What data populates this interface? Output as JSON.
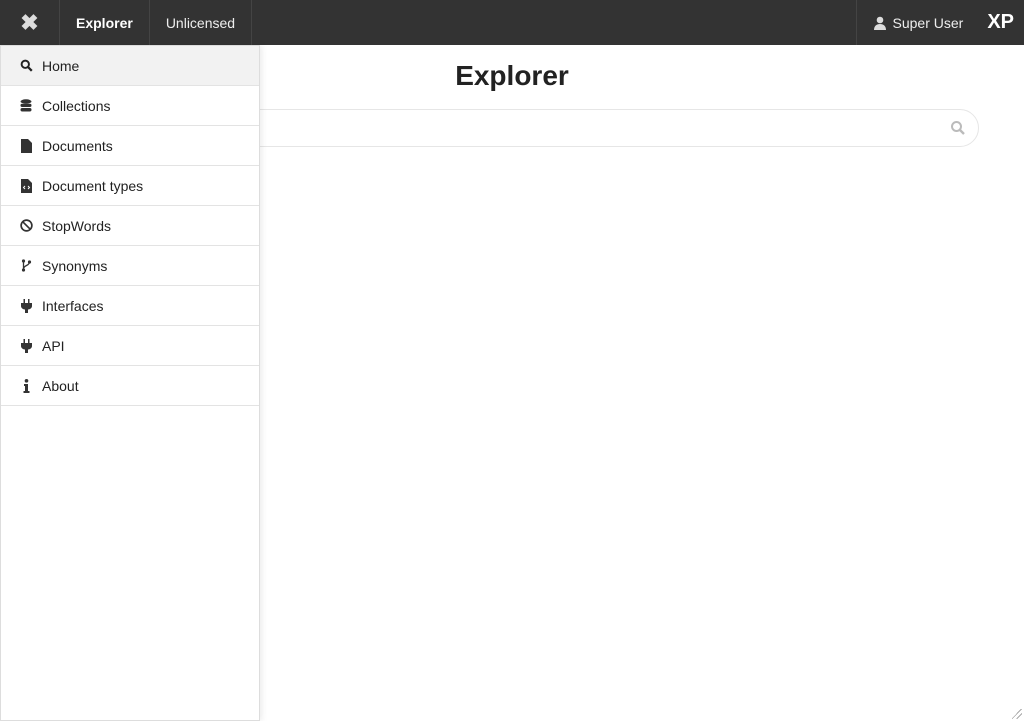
{
  "topbar": {
    "close_icon": "close-icon",
    "app_name": "Explorer",
    "license": "Unlicensed",
    "user": "Super User",
    "logo": "XP"
  },
  "main": {
    "title": "Explorer",
    "search": {
      "value": "",
      "placeholder": ""
    }
  },
  "menu": {
    "items": [
      {
        "label": "Home",
        "icon": "search-icon"
      },
      {
        "label": "Collections",
        "icon": "database-icon"
      },
      {
        "label": "Documents",
        "icon": "file-icon"
      },
      {
        "label": "Document types",
        "icon": "file-code-icon"
      },
      {
        "label": "StopWords",
        "icon": "ban-icon"
      },
      {
        "label": "Synonyms",
        "icon": "code-branch-icon"
      },
      {
        "label": "Interfaces",
        "icon": "plug-icon"
      },
      {
        "label": "API",
        "icon": "plug-icon"
      },
      {
        "label": "About",
        "icon": "info-icon"
      }
    ]
  }
}
